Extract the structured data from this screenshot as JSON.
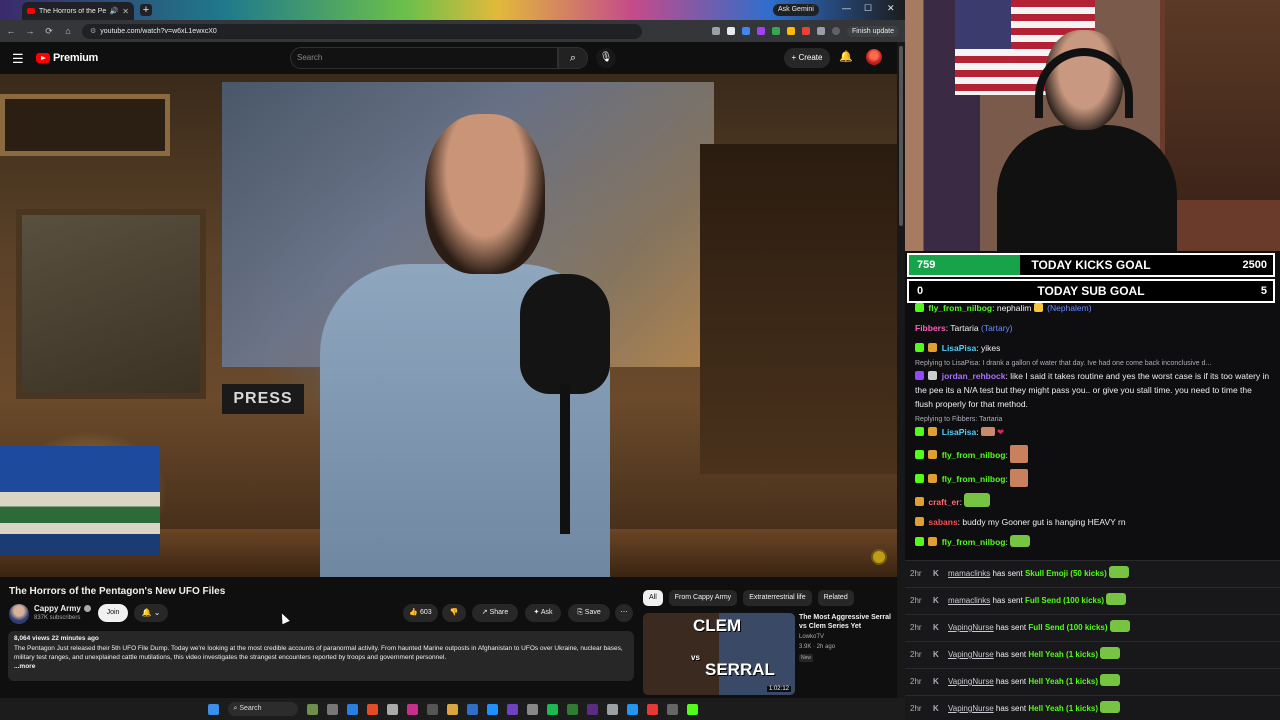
{
  "browser": {
    "tab_title": "The Horrors of the Pentago",
    "url": "youtube.com/watch?v=w6xL1ewxcX0",
    "ask_gemini": "Ask Gemini",
    "finish_update": "Finish update"
  },
  "youtube": {
    "logo": "Premium",
    "search_placeholder": "Search",
    "create_label": "Create",
    "video": {
      "title": "The Horrors of the Pentagon's New UFO Files",
      "press_sign": "PRESS",
      "channel_name": "Cappy Army",
      "subscribers": "837K subscribers",
      "join_label": "Join",
      "likes": "603",
      "share_label": "Share",
      "ask_label": "Ask",
      "save_label": "Save",
      "meta": "8,064 views  22 minutes ago",
      "description": "The Pentagon Just released their 5th UFO File Dump. Today we're looking at the most credible accounts of paranormal activity. From haunted Marine outposts in Afghanistan to UFOs over Ukraine, nuclear bases, military test ranges, and unexplained cattle mutilations, this video investigates the strangest encounters reported by troops and government personnel.",
      "more_label": "...more"
    },
    "related_chips": [
      "All",
      "From Cappy Army",
      "Extraterrestrial life",
      "Related"
    ],
    "related_video": {
      "thumb_line1": "CLEM",
      "thumb_vs": "vs",
      "thumb_line2": "SERRAL",
      "duration": "1:02:12",
      "title": "The Most Aggressive Serral vs Clem Series Yet",
      "channel": "LowkoTV",
      "stats": "3.9K · 2h ago",
      "new_badge": "New"
    }
  },
  "taskbar": {
    "search_label": "Search"
  },
  "goals": [
    {
      "current": "759",
      "label": "TODAY KICKS GOAL",
      "target": "2500",
      "progress": 0.3036
    },
    {
      "current": "0",
      "label": "TODAY SUB GOAL",
      "target": "5",
      "progress": 0
    }
  ],
  "chat": [
    {
      "user": "fly_from_nilbog",
      "text": "nephalim",
      "extra": "(Nephalem)"
    },
    {
      "user": "Fibbers",
      "text": "Tartaria",
      "extra": "(Tartary)"
    },
    {
      "user": "LisaPisa",
      "text": "yikes"
    },
    {
      "reply": "Replying to LisaPisa: I drank a gallon of water that day. Ive had one come back inconclusive d..."
    },
    {
      "user": "jordan_rehbock",
      "text": "like I said it takes routine and yes the worst case is if its too watery in the pee its a N/A test but they might pass you.. or give you stall time. you need to time the flush properly for that method."
    },
    {
      "reply": "Replying to Fibbers: Tartaria"
    },
    {
      "user": "LisaPisa",
      "text": ""
    },
    {
      "user": "fly_from_nilbog",
      "text": ""
    },
    {
      "user": "fly_from_nilbog",
      "text": ""
    },
    {
      "user": "craft_er",
      "text": ""
    },
    {
      "user": "sabans",
      "text": "buddy my Gooner gut is hanging HEAVY rn"
    },
    {
      "user": "fly_from_nilbog",
      "text": ""
    }
  ],
  "events": [
    {
      "time": "2hr",
      "user": "mamaclinks",
      "action": "has sent",
      "gift": "Skull Emoji (50 kicks)"
    },
    {
      "time": "2hr",
      "user": "mamaclinks",
      "action": "has sent",
      "gift": "Full Send (100 kicks)"
    },
    {
      "time": "2hr",
      "user": "VapingNurse",
      "action": "has sent",
      "gift": "Full Send (100 kicks)"
    },
    {
      "time": "2hr",
      "user": "VapingNurse",
      "action": "has sent",
      "gift": "Hell Yeah (1 kicks)"
    },
    {
      "time": "2hr",
      "user": "VapingNurse",
      "action": "has sent",
      "gift": "Hell Yeah (1 kicks)"
    },
    {
      "time": "2hr",
      "user": "VapingNurse",
      "action": "has sent",
      "gift": "Hell Yeah (1 kicks)"
    }
  ],
  "colors": {
    "kick_green": "#53fc18",
    "youtube_red": "#ff0000",
    "goal_fill": "#16a34a"
  }
}
